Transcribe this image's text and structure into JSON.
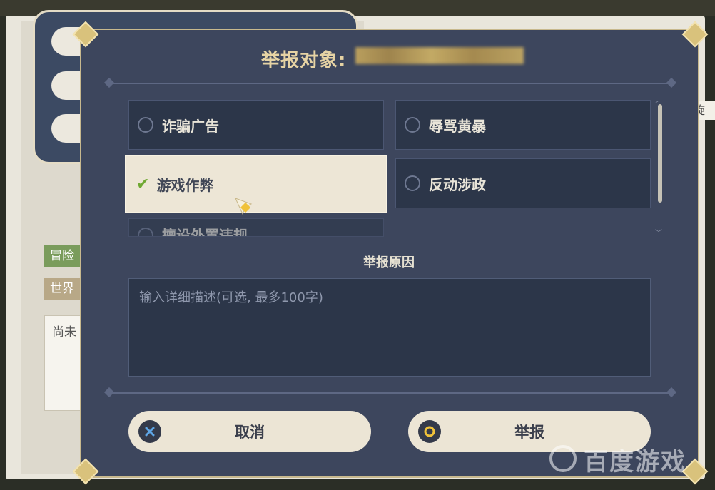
{
  "background": {
    "tags": [
      "冒险",
      "世界"
    ],
    "box_text": "尚未",
    "right_cut_text": "旋"
  },
  "dialog": {
    "title": "举报对象:",
    "options": [
      {
        "label": "诈骗广告",
        "selected": false
      },
      {
        "label": "辱骂黄暴",
        "selected": false
      },
      {
        "label": "游戏作弊",
        "selected": true
      },
      {
        "label": "反动涉政",
        "selected": false
      },
      {
        "label": "擅设外置违规",
        "selected": false
      }
    ],
    "reason_label": "举报原因",
    "reason_placeholder": "输入详细描述(可选, 最多100字)",
    "cancel_label": "取消",
    "report_label": "举报"
  },
  "watermark": "百度游戏",
  "colors": {
    "dialog_bg": "#3d465d",
    "option_bg": "#2c3649",
    "selected_bg": "#ede6d6",
    "title_gold": "#e6d3a4",
    "check_green": "#6fa832",
    "button_bg": "#ece5d5"
  }
}
